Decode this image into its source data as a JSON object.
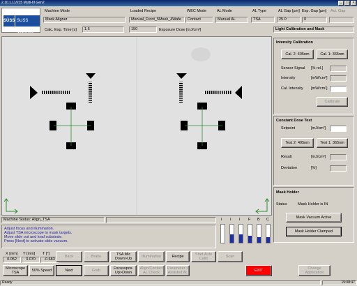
{
  "window": {
    "title": "2.10.1.11/215 Multi-III Gen2"
  },
  "logo": {
    "text": "SUSS MicroTec",
    "mark": "SÜSS"
  },
  "header": {
    "machine_mode_label": "Machine Mode",
    "machine_mode_value": "Mask Aligner",
    "loaded_recipe_label": "Loaded Recipe",
    "loaded_recipe_value": "Manual_Front_5Mask_4Wafe",
    "wec_mode_label": "WEC Mode",
    "wec_mode_value": "Contact",
    "al_mode_label": "AL Mode",
    "al_mode_value": "Manual AL",
    "al_type_label": "AL Type",
    "al_type_value": "TSA",
    "al_gap_label": "AL Gap [µm]",
    "al_gap_value": "25.0",
    "exp_gap_label": "Exp. Gap [µm]",
    "exp_gap_value": "0",
    "act_gap_label": "Act. Gap",
    "calc_exp_time_label": "Calc. Exp. Time [s]",
    "calc_exp_time_value": "1.6",
    "exposure_dose_value": "150",
    "exposure_dose_label": "Exposure Dose [mJ/cm²]",
    "right_tab": "Light Calibration and Mask"
  },
  "intensity": {
    "title": "Intensity Calibration",
    "cal2_button": "Cal. 2: 405nm",
    "cal1_button": "Cal. 1: 365nm",
    "sensor_signal_label": "Sensor Signal",
    "sensor_signal_unit": "[% rel.]",
    "intensity_label": "Intensity",
    "intensity_unit": "[mW/cm²]",
    "cal_intensity_label": "Cal. Intensity",
    "cal_intensity_unit": "[mW/cm²]",
    "calibrate_button": "Calibrate"
  },
  "dose_test": {
    "title": "Constant Dose Test",
    "setpoint_label": "Setpoint",
    "setpoint_unit": "[mJ/cm²]",
    "test2_button": "Test 2: 405nm",
    "test1_button": "Test 1: 365nm",
    "result_label": "Result",
    "result_unit": "[mJ/cm²]",
    "deviation_label": "Deviation",
    "deviation_unit": "[%]"
  },
  "mask_holder": {
    "title": "Mask Holder",
    "status_label": "Status",
    "status_value": "Mask Holder is IN",
    "vacuum_button": "Mask Vacuum Active",
    "clamped_button": "Mask Holder Clamped"
  },
  "machine_status": {
    "label": "Machine Status: Align_TSA",
    "messages": [
      "Adjust focus and illumination.",
      "Adjust TSA microscope to mask targets.",
      "Move slide out and load substrate.",
      "Press [Next] to activate slide vacuum."
    ]
  },
  "gauges": {
    "labels": [
      "I",
      "I",
      "I",
      "F",
      "B",
      "C"
    ],
    "levels": [
      0,
      0.45,
      0.45,
      0.4,
      0.3,
      0.3
    ]
  },
  "coords": {
    "x_label": "X [mm]",
    "x_value": "0.052",
    "y_label": "Y [mm]",
    "y_value": "3.070",
    "t_label": "T [°]",
    "t_value": "-0.683"
  },
  "controls": {
    "microscope_button": "Microscope TSA",
    "speed_button": "50% Speed",
    "back_button": "Back",
    "next_button": "Next",
    "brake_button": "Brake",
    "grab_button": "Grab",
    "tsa_mic_button": "TSA Mic Down>Up",
    "focus_button": "Focusspos. Up>Down",
    "illumination_button": "Illumination",
    "align_contact_button": "Align/Contact AL Check",
    "recipe_button": "Recipe",
    "parameter_button": "Parameter > Assisted AL",
    "start_auto_calib_button": "Start Auto Calib",
    "scan_button": "Scan",
    "exit_button": "EXIT",
    "change_app_button": "Change Application"
  },
  "statusbar": {
    "left": "Ready",
    "right": "19:08:47"
  },
  "colors": {
    "titlebar": "#0a246a",
    "message_text": "#1d1da0",
    "gauge_fill": "#1e2ea5",
    "exit_red": "#ff0000",
    "crosshair_green": "#2e8b2e"
  }
}
